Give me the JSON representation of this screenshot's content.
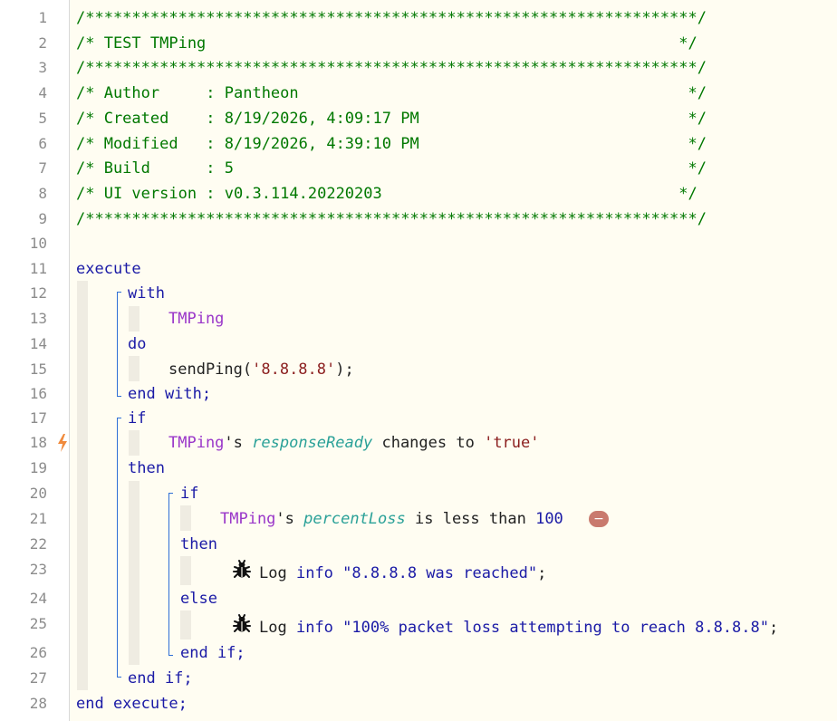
{
  "line_numbers": [
    "1",
    "2",
    "3",
    "4",
    "5",
    "6",
    "7",
    "8",
    "9",
    "10",
    "11",
    "12",
    "13",
    "14",
    "15",
    "16",
    "17",
    "18",
    "19",
    "20",
    "21",
    "22",
    "23",
    "24",
    "25",
    "26",
    "27",
    "28"
  ],
  "header": {
    "border": "/******************************************************************/",
    "title": "/* TEST TMPing                                                   */",
    "author": "/* Author     : Pantheon                                          */",
    "created": "/* Created    : 8/19/2026, 4:09:17 PM                             */",
    "modified": "/* Modified   : 8/19/2026, 4:39:10 PM                             */",
    "build": "/* Build      : 5                                                 */",
    "ui_version": "/* UI version : v0.3.114.20220203                                */"
  },
  "code": {
    "execute": "execute",
    "with": "with",
    "device": "TMPing",
    "do": "do",
    "send_call_prefix": "sendPing(",
    "send_arg": "'8.8.8.8'",
    "send_call_suffix": ");",
    "end_with": "end with;",
    "if_outer": "if",
    "possessive": "'s",
    "prop_response": "responseReady",
    "changes_to": "changes to",
    "true_literal": "'true'",
    "then_outer": "then",
    "if_inner": "if",
    "prop_loss": "percentLoss",
    "is_less_than": "is less than",
    "loss_value": "100",
    "minus_symbol": "−",
    "then_inner": "then",
    "log_word": "Log",
    "log_level": "info",
    "msg_reached": "\"8.8.8.8 was reached\"",
    "semicolon": ";",
    "else": "else",
    "msg_loss": "\"100% packet loss attempting to reach 8.8.8.8\"",
    "end_if_inner": "end if;",
    "end_if_outer": "end if;",
    "end_execute": "end execute;"
  },
  "icons": {
    "trigger_marker": "lightning-icon",
    "log_action": "bug-icon",
    "remove_condition": "minus-icon"
  },
  "colors": {
    "comment": "#007800",
    "keyword": "#1a1aa6",
    "device": "#9a36c9",
    "property": "#2aa198",
    "string": "#8b1e1e",
    "trigger_marker": "#f08a3c"
  }
}
